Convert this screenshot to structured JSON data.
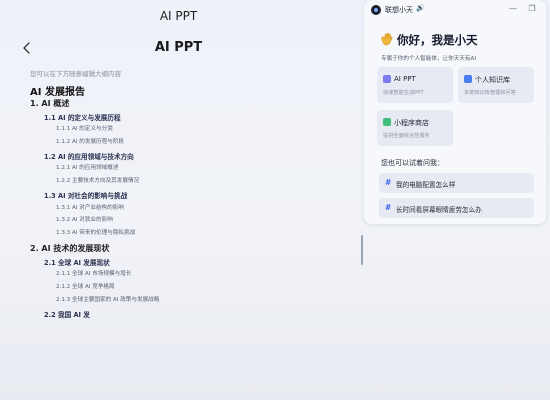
{
  "window": {
    "title": "AI PPT"
  },
  "page": {
    "title": "AI PPT",
    "hint": "您可以在下方随意编辑大纲内容"
  },
  "outline": [
    {
      "level": 0,
      "text": "AI 发展报告"
    },
    {
      "level": 1,
      "text": "1. AI 概述"
    },
    {
      "level": 2,
      "text": "1.1 AI 的定义与发展历程"
    },
    {
      "level": 3,
      "text": "1.1.1 AI 的定义与分类"
    },
    {
      "level": 3,
      "text": "1.1.2 AI 的发展历程与阶段"
    },
    {
      "level": 2,
      "text": "1.2 AI 的应用领域与技术方向"
    },
    {
      "level": 3,
      "text": "1.2.1 AI 的应用领域概述"
    },
    {
      "level": 3,
      "text": "1.2.2 主要技术方向及其发展情况"
    },
    {
      "level": 2,
      "text": "1.3 AI 对社会的影响与挑战"
    },
    {
      "level": 3,
      "text": "1.3.1 AI 对产业结构的影响"
    },
    {
      "level": 3,
      "text": "1.3.2 AI 对就业的影响"
    },
    {
      "level": 3,
      "text": "1.3.3 AI 带来的伦理与隐私挑战"
    },
    {
      "level": 1,
      "text": "2. AI 技术的发展现状"
    },
    {
      "level": 2,
      "text": "2.1 全球 AI 发展现状"
    },
    {
      "level": 3,
      "text": "2.1.1 全球 AI 市场规模与增长"
    },
    {
      "level": 3,
      "text": "2.1.2 全球 AI 竞争格局"
    },
    {
      "level": 3,
      "text": "2.1.3 全球主要国家的 AI 政策与发展战略"
    },
    {
      "level": 2,
      "text": "2.2 我国 AI 发"
    }
  ],
  "assistant": {
    "name": "联想小天",
    "sound_icon": "speaker-icon",
    "greeting": "你好，我是小天",
    "subtitle": "专属于你的个人智能体，让你天天有AI",
    "cards": [
      {
        "title": "AI PPT",
        "desc": "快速智能生成PPT",
        "icon": "ppt-icon",
        "color": "#7b7cf0"
      },
      {
        "title": "个人知识库",
        "desc": "本地知识库管理和问答",
        "icon": "knowledge-base-icon",
        "color": "#4a7cf2"
      },
      {
        "title": "小程序商店",
        "desc": "提供全面综合性服务",
        "icon": "mini-program-store-icon",
        "color": "#3fbf7a"
      }
    ],
    "try_label": "您也可以试着问我：",
    "suggestions": [
      "我的电脑配置怎么样",
      "长时间看屏幕眼睛疲劳怎么办"
    ]
  },
  "colors": {
    "accent": "#3d63e8",
    "background": "#eef1f8",
    "card": "#e7eaf3"
  }
}
